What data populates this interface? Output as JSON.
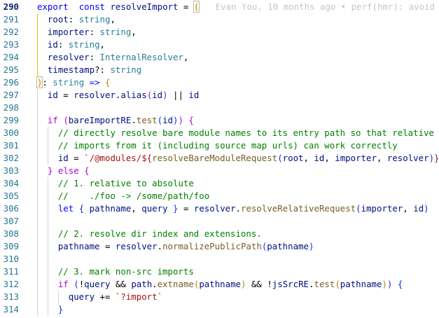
{
  "editor": {
    "active_line": 290,
    "blame": "Evan You, 10 months ago • perf(hmr): avoid",
    "lines": [
      {
        "n": 290,
        "guides": [],
        "tokens": [
          [
            "kw",
            "export"
          ],
          [
            "",
            "  "
          ],
          [
            "kw",
            "const"
          ],
          [
            "",
            " "
          ],
          [
            "va",
            "resolveImport"
          ],
          [
            "",
            " = "
          ],
          [
            "b1 bh",
            "("
          ],
          [
            "cursor",
            ""
          ],
          [
            "",
            " "
          ]
        ],
        "blame": true
      },
      {
        "n": 291,
        "guides": [
          0
        ],
        "tokens": [
          [
            "",
            "  "
          ],
          [
            "va",
            "root"
          ],
          [
            "",
            ": "
          ],
          [
            "ty",
            "string"
          ],
          [
            "",
            ","
          ]
        ]
      },
      {
        "n": 292,
        "guides": [
          0
        ],
        "tokens": [
          [
            "",
            "  "
          ],
          [
            "va",
            "importer"
          ],
          [
            "",
            ": "
          ],
          [
            "ty",
            "string"
          ],
          [
            "",
            ","
          ]
        ]
      },
      {
        "n": 293,
        "guides": [
          0
        ],
        "tokens": [
          [
            "",
            "  "
          ],
          [
            "va",
            "id"
          ],
          [
            "",
            ": "
          ],
          [
            "ty",
            "string"
          ],
          [
            "",
            ","
          ]
        ]
      },
      {
        "n": 294,
        "guides": [
          0
        ],
        "tokens": [
          [
            "",
            "  "
          ],
          [
            "va",
            "resolver"
          ],
          [
            "",
            ": "
          ],
          [
            "ty",
            "InternalResolver"
          ],
          [
            "",
            ","
          ]
        ]
      },
      {
        "n": 295,
        "guides": [
          0
        ],
        "tokens": [
          [
            "",
            "  "
          ],
          [
            "va",
            "timestamp"
          ],
          [
            "",
            "?: "
          ],
          [
            "ty",
            "string"
          ]
        ]
      },
      {
        "n": 296,
        "guides": [],
        "tokens": [
          [
            "b1 bh",
            ")"
          ],
          [
            "",
            ": "
          ],
          [
            "ty",
            "string"
          ],
          [
            "",
            " "
          ],
          [
            "kw",
            "=>"
          ],
          [
            "",
            " "
          ],
          [
            "b1",
            "{"
          ]
        ]
      },
      {
        "n": 297,
        "guides": [
          0
        ],
        "tokens": [
          [
            "",
            "  "
          ],
          [
            "va",
            "id"
          ],
          [
            "",
            " = "
          ],
          [
            "va",
            "resolver"
          ],
          [
            "",
            "."
          ],
          [
            "va",
            "alias"
          ],
          [
            "b2",
            "("
          ],
          [
            "va",
            "id"
          ],
          [
            "b2",
            ")"
          ],
          [
            "",
            " || "
          ],
          [
            "va",
            "id"
          ]
        ]
      },
      {
        "n": 298,
        "guides": [
          0
        ],
        "tokens": []
      },
      {
        "n": 299,
        "guides": [
          0
        ],
        "tokens": [
          [
            "",
            "  "
          ],
          [
            "kc",
            "if"
          ],
          [
            "",
            " "
          ],
          [
            "b2",
            "("
          ],
          [
            "va",
            "bareImportRE"
          ],
          [
            "",
            "."
          ],
          [
            "fn",
            "test"
          ],
          [
            "b3",
            "("
          ],
          [
            "va",
            "id"
          ],
          [
            "b3",
            ")"
          ],
          [
            "b2",
            ")"
          ],
          [
            "",
            " "
          ],
          [
            "b2",
            "{"
          ]
        ]
      },
      {
        "n": 300,
        "guides": [
          0,
          1
        ],
        "tokens": [
          [
            "",
            "    "
          ],
          [
            "cm",
            "// directly resolve bare module names to its entry path so that relative"
          ]
        ]
      },
      {
        "n": 301,
        "guides": [
          0,
          1
        ],
        "tokens": [
          [
            "",
            "    "
          ],
          [
            "cm",
            "// imports from it (including source map urls) can work correctly"
          ]
        ]
      },
      {
        "n": 302,
        "guides": [
          0,
          1
        ],
        "tokens": [
          [
            "",
            "    "
          ],
          [
            "va",
            "id"
          ],
          [
            "",
            " = "
          ],
          [
            "str",
            "`/@modules/${"
          ],
          [
            "fn",
            "resolveBareModuleRequest"
          ],
          [
            "b3",
            "("
          ],
          [
            "va",
            "root"
          ],
          [
            "",
            ", "
          ],
          [
            "va",
            "id"
          ],
          [
            "",
            ", "
          ],
          [
            "va",
            "importer"
          ],
          [
            "",
            ", "
          ],
          [
            "va",
            "resolver"
          ],
          [
            "b3",
            ")"
          ],
          [
            "str",
            "}`"
          ]
        ]
      },
      {
        "n": 303,
        "guides": [
          0
        ],
        "tokens": [
          [
            "",
            "  "
          ],
          [
            "b2",
            "}"
          ],
          [
            "",
            " "
          ],
          [
            "kc",
            "else"
          ],
          [
            "",
            " "
          ],
          [
            "b2",
            "{"
          ]
        ]
      },
      {
        "n": 304,
        "guides": [
          0,
          1
        ],
        "tokens": [
          [
            "",
            "    "
          ],
          [
            "cm",
            "// 1. relative to absolute"
          ]
        ]
      },
      {
        "n": 305,
        "guides": [
          0,
          1
        ],
        "tokens": [
          [
            "",
            "    "
          ],
          [
            "cm",
            "//    ./foo -> /some/path/foo"
          ]
        ]
      },
      {
        "n": 306,
        "guides": [
          0,
          1
        ],
        "tokens": [
          [
            "",
            "    "
          ],
          [
            "kw",
            "let"
          ],
          [
            "",
            " "
          ],
          [
            "b3",
            "{"
          ],
          [
            "",
            " "
          ],
          [
            "va",
            "pathname"
          ],
          [
            "",
            ", "
          ],
          [
            "va",
            "query"
          ],
          [
            "",
            " "
          ],
          [
            "b3",
            "}"
          ],
          [
            "",
            " = "
          ],
          [
            "va",
            "resolver"
          ],
          [
            "",
            "."
          ],
          [
            "fn",
            "resolveRelativeRequest"
          ],
          [
            "b3",
            "("
          ],
          [
            "va",
            "importer"
          ],
          [
            "",
            ", "
          ],
          [
            "va",
            "id"
          ],
          [
            "b3",
            ")"
          ]
        ]
      },
      {
        "n": 307,
        "guides": [
          0,
          1
        ],
        "tokens": []
      },
      {
        "n": 308,
        "guides": [
          0,
          1
        ],
        "tokens": [
          [
            "",
            "    "
          ],
          [
            "cm",
            "// 2. resolve dir index and extensions."
          ]
        ]
      },
      {
        "n": 309,
        "guides": [
          0,
          1
        ],
        "tokens": [
          [
            "",
            "    "
          ],
          [
            "va",
            "pathname"
          ],
          [
            "",
            " = "
          ],
          [
            "va",
            "resolver"
          ],
          [
            "",
            "."
          ],
          [
            "fn",
            "normalizePublicPath"
          ],
          [
            "b3",
            "("
          ],
          [
            "va",
            "pathname"
          ],
          [
            "b3",
            ")"
          ]
        ]
      },
      {
        "n": 310,
        "guides": [
          0,
          1
        ],
        "tokens": []
      },
      {
        "n": 311,
        "guides": [
          0,
          1
        ],
        "tokens": [
          [
            "",
            "    "
          ],
          [
            "cm",
            "// 3. mark non-src imports"
          ]
        ]
      },
      {
        "n": 312,
        "guides": [
          0,
          1
        ],
        "tokens": [
          [
            "",
            "    "
          ],
          [
            "kc",
            "if"
          ],
          [
            "",
            " "
          ],
          [
            "b3",
            "("
          ],
          [
            "",
            "!"
          ],
          [
            "va",
            "query"
          ],
          [
            "",
            " && "
          ],
          [
            "va",
            "path"
          ],
          [
            "",
            "."
          ],
          [
            "fn",
            "extname"
          ],
          [
            "b1",
            "("
          ],
          [
            "va",
            "pathname"
          ],
          [
            "b1",
            ")"
          ],
          [
            "",
            " && !"
          ],
          [
            "va",
            "jsSrcRE"
          ],
          [
            "",
            "."
          ],
          [
            "fn",
            "test"
          ],
          [
            "b1",
            "("
          ],
          [
            "va",
            "pathname"
          ],
          [
            "b1",
            ")"
          ],
          [
            "b3",
            ")"
          ],
          [
            "",
            " "
          ],
          [
            "b3",
            "{"
          ]
        ]
      },
      {
        "n": 313,
        "guides": [
          0,
          1,
          2
        ],
        "tokens": [
          [
            "",
            "      "
          ],
          [
            "va",
            "query"
          ],
          [
            "",
            " += "
          ],
          [
            "str",
            "`?import`"
          ]
        ]
      },
      {
        "n": 314,
        "guides": [
          0,
          1
        ],
        "tokens": [
          [
            "",
            "    "
          ],
          [
            "b3",
            "}"
          ]
        ]
      }
    ]
  }
}
